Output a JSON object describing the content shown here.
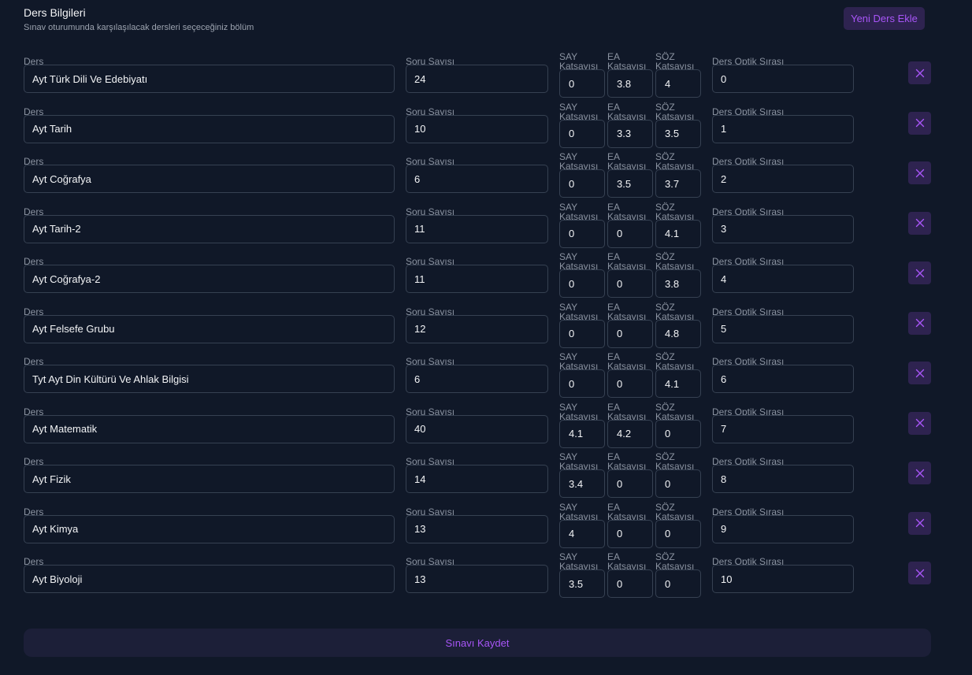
{
  "header": {
    "title": "Ders Bilgileri",
    "subtitle": "Sınav oturumunda karşılaşılacak dersleri seçeceğiniz bölüm",
    "add_button_label": "Yeni Ders Ekle"
  },
  "labels": {
    "ders": "Ders",
    "soru_sayisi": "Soru Sayısı",
    "say_line1": "SAY",
    "ea_line1": "EA",
    "soz_line1": "SÖZ",
    "katsayisi": "Katsayısı",
    "optik": "Ders Optik Sırası"
  },
  "icons": {
    "delete": "close-icon"
  },
  "colors": {
    "accent": "#a855f7",
    "background": "#101828",
    "button_bg": "#2e2350"
  },
  "rows": [
    {
      "ders": "Ayt Türk Dili Ve Edebiyatı",
      "soru": "24",
      "say": "0",
      "ea": "3.8",
      "soz": "4",
      "optik": "0"
    },
    {
      "ders": "Ayt Tarih",
      "soru": "10",
      "say": "0",
      "ea": "3.3",
      "soz": "3.5",
      "optik": "1"
    },
    {
      "ders": "Ayt Coğrafya",
      "soru": "6",
      "say": "0",
      "ea": "3.5",
      "soz": "3.7",
      "optik": "2"
    },
    {
      "ders": "Ayt Tarih-2",
      "soru": "11",
      "say": "0",
      "ea": "0",
      "soz": "4.1",
      "optik": "3"
    },
    {
      "ders": "Ayt Coğrafya-2",
      "soru": "11",
      "say": "0",
      "ea": "0",
      "soz": "3.8",
      "optik": "4"
    },
    {
      "ders": "Ayt Felsefe Grubu",
      "soru": "12",
      "say": "0",
      "ea": "0",
      "soz": "4.8",
      "optik": "5"
    },
    {
      "ders": "Tyt Ayt Din Kültürü Ve Ahlak Bilgisi",
      "soru": "6",
      "say": "0",
      "ea": "0",
      "soz": "4.1",
      "optik": "6"
    },
    {
      "ders": "Ayt Matematik",
      "soru": "40",
      "say": "4.1",
      "ea": "4.2",
      "soz": "0",
      "optik": "7"
    },
    {
      "ders": "Ayt Fizik",
      "soru": "14",
      "say": "3.4",
      "ea": "0",
      "soz": "0",
      "optik": "8"
    },
    {
      "ders": "Ayt Kimya",
      "soru": "13",
      "say": "4",
      "ea": "0",
      "soz": "0",
      "optik": "9"
    },
    {
      "ders": "Ayt Biyoloji",
      "soru": "13",
      "say": "3.5",
      "ea": "0",
      "soz": "0",
      "optik": "10"
    }
  ],
  "footer": {
    "save_label": "Sınavı Kaydet"
  }
}
